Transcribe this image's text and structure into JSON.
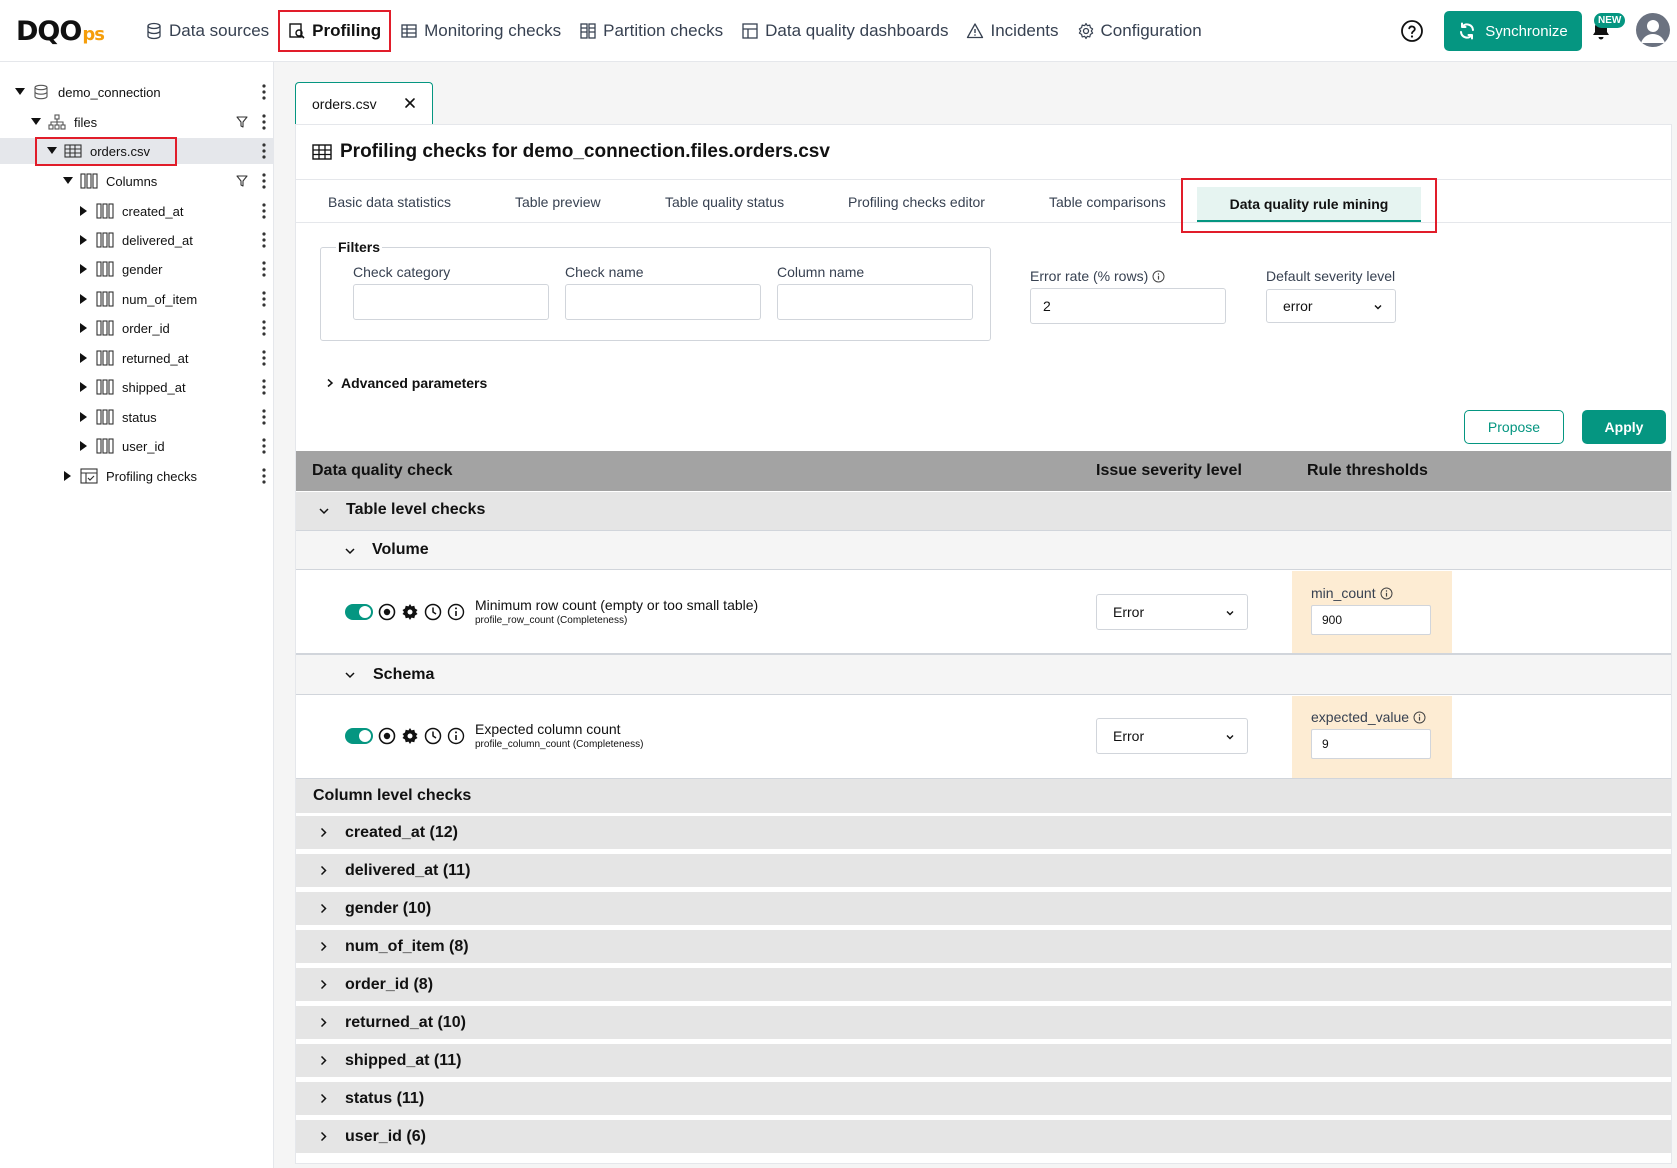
{
  "logo": {
    "main": "DQO",
    "suffix": "ps"
  },
  "nav": [
    {
      "label": "Data sources",
      "icon": "database-icon"
    },
    {
      "label": "Profiling",
      "icon": "profiling-icon",
      "active": true
    },
    {
      "label": "Monitoring checks",
      "icon": "table-icon"
    },
    {
      "label": "Partition checks",
      "icon": "partition-icon"
    },
    {
      "label": "Data quality dashboards",
      "icon": "dashboard-icon"
    },
    {
      "label": "Incidents",
      "icon": "warning-icon"
    },
    {
      "label": "Configuration",
      "icon": "gear-icon"
    }
  ],
  "header": {
    "sync_label": "Synchronize",
    "new_badge": "NEW"
  },
  "tree": [
    {
      "label": "demo_connection",
      "icon": "database-icon",
      "expanded": true
    },
    {
      "label": "files",
      "icon": "schema-icon",
      "expanded": true
    },
    {
      "label": "orders.csv",
      "icon": "table-icon",
      "expanded": true,
      "selected": true
    },
    {
      "label": "Columns",
      "icon": "columns-icon",
      "expanded": true
    },
    {
      "label": "created_at",
      "icon": "column-icon"
    },
    {
      "label": "delivered_at",
      "icon": "column-icon"
    },
    {
      "label": "gender",
      "icon": "column-icon"
    },
    {
      "label": "num_of_item",
      "icon": "column-icon"
    },
    {
      "label": "order_id",
      "icon": "column-icon"
    },
    {
      "label": "returned_at",
      "icon": "column-icon"
    },
    {
      "label": "shipped_at",
      "icon": "column-icon"
    },
    {
      "label": "status",
      "icon": "column-icon"
    },
    {
      "label": "user_id",
      "icon": "column-icon"
    },
    {
      "label": "Profiling checks",
      "icon": "checks-icon"
    }
  ],
  "file_tab": {
    "label": "orders.csv"
  },
  "panel": {
    "title": "Profiling checks for demo_connection.files.orders.csv"
  },
  "subtabs": [
    {
      "label": "Basic data statistics"
    },
    {
      "label": "Table preview"
    },
    {
      "label": "Table quality status"
    },
    {
      "label": "Profiling checks editor"
    },
    {
      "label": "Table comparisons"
    },
    {
      "label": "Data quality rule mining",
      "active": true
    }
  ],
  "filters": {
    "legend": "Filters",
    "check_category_label": "Check category",
    "check_name_label": "Check name",
    "column_name_label": "Column name",
    "check_category_value": "",
    "check_name_value": "",
    "column_name_value": ""
  },
  "error_rate": {
    "label": "Error rate (% rows)",
    "value": "2"
  },
  "default_severity": {
    "label": "Default severity level",
    "value": "error"
  },
  "advanced": {
    "label": "Advanced parameters"
  },
  "actions": {
    "propose": "Propose",
    "apply": "Apply"
  },
  "table": {
    "headers": {
      "check": "Data quality check",
      "severity": "Issue severity level",
      "thresholds": "Rule thresholds"
    },
    "table_level": "Table level checks",
    "volume": {
      "label": "Volume",
      "check_name": "Minimum row count (empty or too small table)",
      "check_sub": "profile_row_count (Completeness)",
      "severity": "Error",
      "threshold_label": "min_count",
      "threshold_value": "900"
    },
    "schema": {
      "label": "Schema",
      "check_name": "Expected column count",
      "check_sub": "profile_column_count (Completeness)",
      "severity": "Error",
      "threshold_label": "expected_value",
      "threshold_value": "9"
    },
    "column_level": "Column level checks",
    "columns": [
      "created_at (12)",
      "delivered_at (11)",
      "gender (10)",
      "num_of_item (8)",
      "order_id (8)",
      "returned_at (10)",
      "shipped_at (11)",
      "status (11)",
      "user_id (6)"
    ]
  },
  "colors": {
    "accent": "#059681",
    "highlight": "#e11d2a",
    "threshold_bg": "#fdecd3"
  }
}
